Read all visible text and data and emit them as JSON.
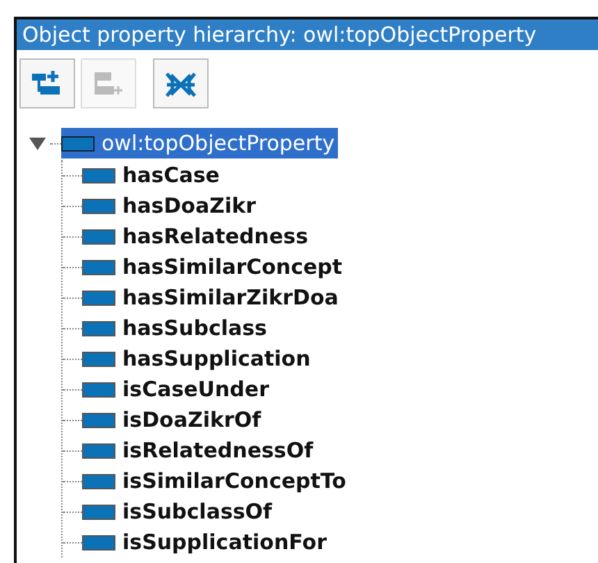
{
  "panel": {
    "title": "Object property hierarchy: owl:topObjectProperty"
  },
  "toolbar": [
    {
      "kind": "add-sub",
      "disabled": false
    },
    {
      "kind": "add-sibling",
      "disabled": true
    },
    {
      "kind": "delete",
      "disabled": false
    }
  ],
  "tree": [
    {
      "label": "owl:topObjectProperty",
      "selected": true,
      "expanded": true,
      "children": [
        {
          "label": "hasCase",
          "selected": false
        },
        {
          "label": "hasDoaZikr",
          "selected": false
        },
        {
          "label": "hasRelatedness",
          "selected": false
        },
        {
          "label": "hasSimilarConcept",
          "selected": false
        },
        {
          "label": "hasSimilarZikrDoa",
          "selected": false
        },
        {
          "label": "hasSubclass",
          "selected": false
        },
        {
          "label": "hasSupplication",
          "selected": false
        },
        {
          "label": "isCaseUnder",
          "selected": false
        },
        {
          "label": "isDoaZikrOf",
          "selected": false
        },
        {
          "label": "isRelatednessOf",
          "selected": false
        },
        {
          "label": "isSimilarConceptTo",
          "selected": false
        },
        {
          "label": "isSubclassOf",
          "selected": false
        },
        {
          "label": "isSupplicationFor",
          "selected": false
        }
      ]
    }
  ]
}
